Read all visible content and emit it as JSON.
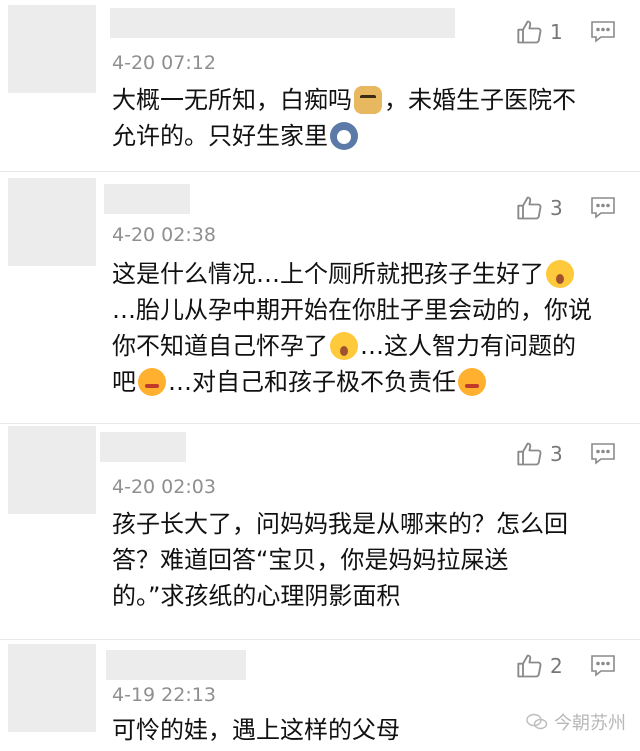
{
  "comments": [
    {
      "time": "4-20 07:12",
      "likes": "1",
      "lines": [
        [
          {
            "t": "大概一无所知，白痴吗"
          },
          {
            "emoji": "doge-icon"
          },
          {
            "t": "，未婚生子医院不"
          }
        ],
        [
          {
            "t": "允许的。只好生家里"
          },
          {
            "emoji": "husky-icon"
          }
        ]
      ]
    },
    {
      "time": "4-20 02:38",
      "likes": "3",
      "lines": [
        [
          {
            "t": "这是什么情况…上个厕所就把孩子生好了"
          },
          {
            "emoji": "shocked-face-icon"
          }
        ],
        [
          {
            "t": "…胎儿从孕中期开始在你肚子里会动的，你说"
          }
        ],
        [
          {
            "t": "你不知道自己怀孕了"
          },
          {
            "emoji": "shocked-face-icon"
          },
          {
            "t": "…这人智力有问题的"
          }
        ],
        [
          {
            "t": "吧"
          },
          {
            "emoji": "angry-face-icon"
          },
          {
            "t": "…对自己和孩子极不负责任"
          },
          {
            "emoji": "angry-face-icon"
          }
        ]
      ]
    },
    {
      "time": "4-20 02:03",
      "likes": "3",
      "lines": [
        [
          {
            "t": "孩子长大了，问妈妈我是从哪来的？怎么回"
          }
        ],
        [
          {
            "t": "答？难道回答“宝贝，你是妈妈拉屎送"
          }
        ],
        [
          {
            "t": "的。”求孩纸的心理阴影面积"
          }
        ]
      ]
    },
    {
      "time": "4-19 22:13",
      "likes": "2",
      "lines": [
        [
          {
            "t": "可怜的娃，遇上这样的父母"
          }
        ]
      ]
    }
  ],
  "watermark": {
    "text": "今朝苏州"
  }
}
